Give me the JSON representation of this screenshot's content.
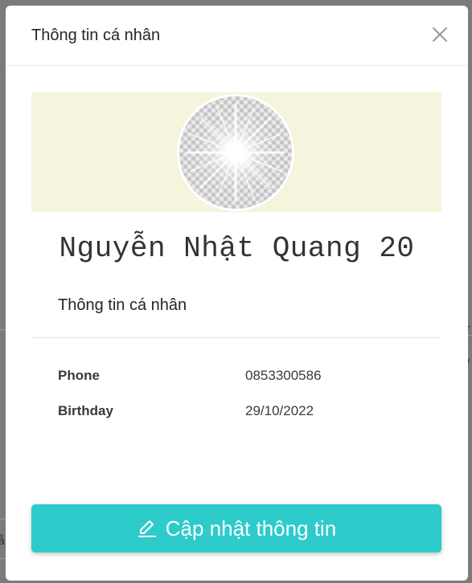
{
  "modal": {
    "title": "Thông tin cá nhân",
    "close_icon": "close-icon"
  },
  "profile": {
    "cover_color": "#f5f4dc",
    "avatar_icon": "avatar-sunburst-placeholder",
    "name": "Nguyễn Nhật Quang 20"
  },
  "section": {
    "title": "Thông tin cá nhân"
  },
  "info": [
    {
      "label": "Phone",
      "value": "0853300586"
    },
    {
      "label": "Birthday",
      "value": "29/10/2022"
    }
  ],
  "actions": {
    "update_label": "Cập nhật thông tin",
    "update_icon": "edit-pencil-icon",
    "accent_color": "#2ecbcb"
  },
  "backdrop": {
    "glyph_left_1": "ẫ",
    "glyph_right_1": "r",
    "glyph_right_2": "/"
  }
}
